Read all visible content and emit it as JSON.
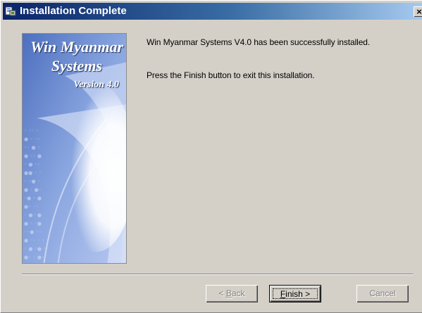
{
  "window": {
    "title": "Installation Complete",
    "title_icon": "installer-icon",
    "close_glyph": "×"
  },
  "banner": {
    "line1": "Win Myanmar",
    "line2": "Systems",
    "line3": "Version 4.0"
  },
  "message": {
    "line1": "Win Myanmar Systems V4.0 has been successfully installed.",
    "line2": "Press the Finish button to exit this installation."
  },
  "buttons": {
    "back": {
      "prefix": "< ",
      "accel": "B",
      "rest": "ack",
      "enabled": false
    },
    "finish": {
      "accel": "F",
      "rest": "inish >",
      "enabled": true
    },
    "cancel": {
      "label": "Cancel",
      "enabled": false
    }
  },
  "colors": {
    "titlebar_start": "#0a246a",
    "titlebar_end": "#a6caf0",
    "dialog_bg": "#d4d0c8",
    "disabled_text": "#808080"
  }
}
